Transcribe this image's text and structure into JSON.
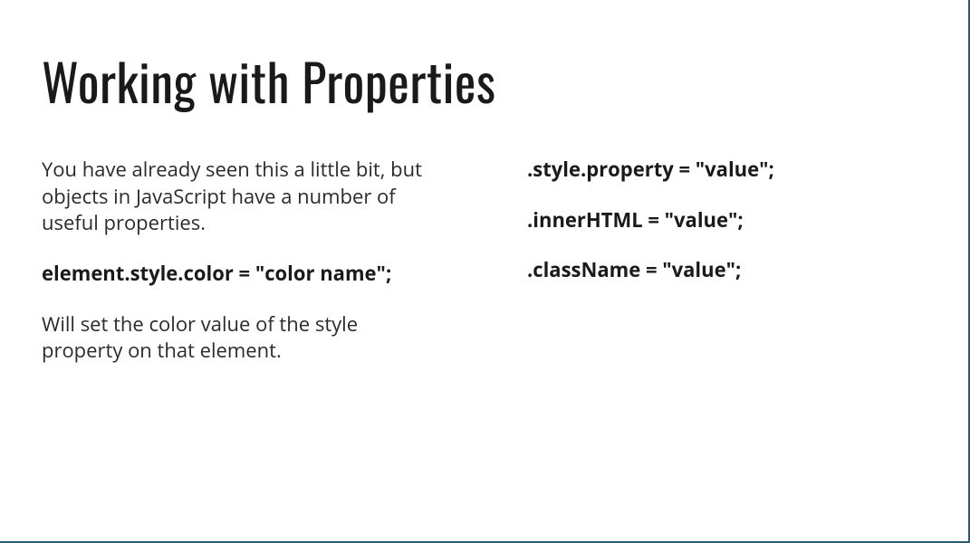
{
  "slide": {
    "title": "Working with Properties",
    "left": {
      "para1": "You have already seen this a little bit, but objects in JavaScript have a number of useful properties.",
      "code1": "element.style.color = \"color name\";",
      "para2": "Will set the color value of the style property on that element."
    },
    "right": {
      "line1": ".style.property = \"value\";",
      "line2": ".innerHTML = \"value\";",
      "line3": ".className = \"value\";"
    }
  }
}
